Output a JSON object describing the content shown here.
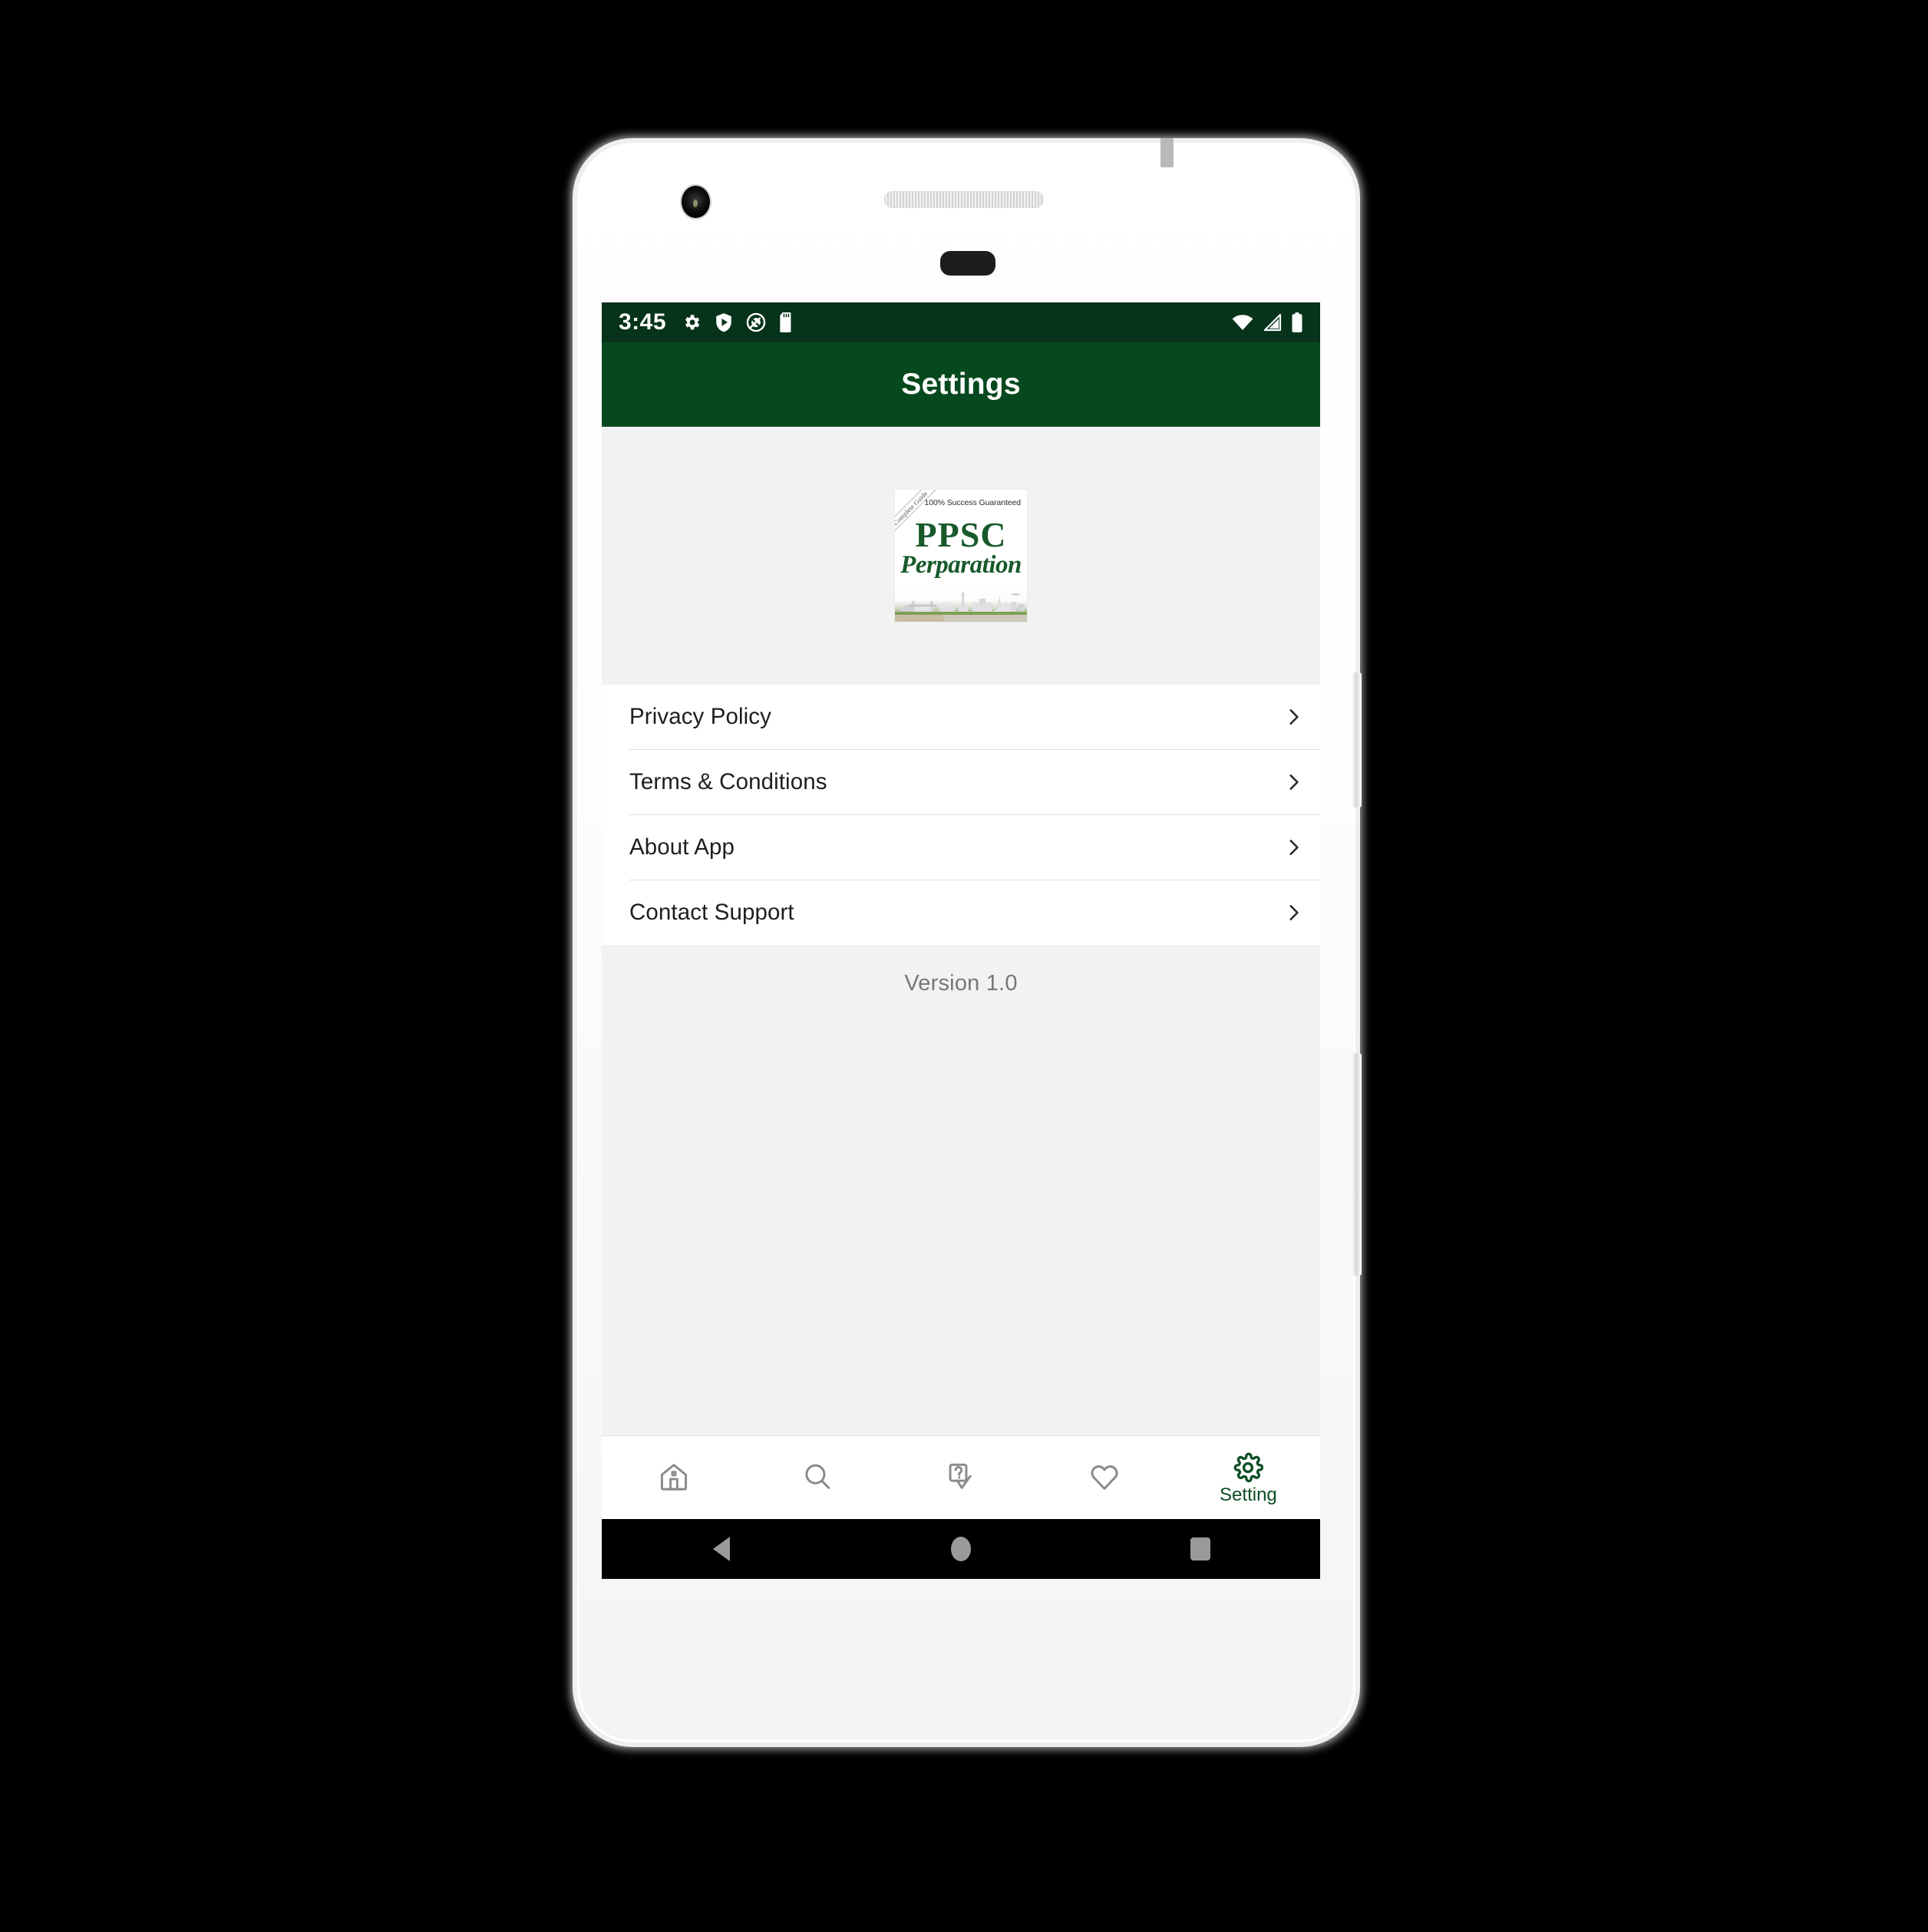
{
  "device": {
    "frame_name": "white-android-phone-mockup",
    "camera_icon": "front-camera-icon",
    "speaker_icon": "earpiece-speaker-icon",
    "power_button": "power-button",
    "volume_button": "volume-button"
  },
  "status_bar": {
    "time": "3:45",
    "left_icons": [
      "gear-icon",
      "play-protect-shield-icon",
      "do-not-disturb-icon",
      "sd-card-icon"
    ],
    "right_icons": [
      "wifi-icon",
      "cellular-signal-icon",
      "battery-full-icon"
    ],
    "background": "#06331a"
  },
  "app_bar": {
    "title": "Settings",
    "background": "#07491e",
    "text_color": "#ffffff"
  },
  "logo": {
    "ribbon": "Complete Guide",
    "tagline": "100% Success Guaranteed",
    "title": "PPSC",
    "subtitle": "Perparation",
    "skyline_icon": "pakistan-skyline-illustration",
    "section_background": "#f2f2f2"
  },
  "settings_list": {
    "items": [
      {
        "label": "Privacy Policy",
        "name": "privacy-policy",
        "chevron": "chevron-right-icon"
      },
      {
        "label": "Terms & Conditions",
        "name": "terms-conditions",
        "chevron": "chevron-right-icon"
      },
      {
        "label": "About App",
        "name": "about-app",
        "chevron": "chevron-right-icon"
      },
      {
        "label": "Contact Support",
        "name": "contact-support",
        "chevron": "chevron-right-icon"
      }
    ]
  },
  "version": {
    "text": "Version 1.0",
    "color": "#777777"
  },
  "bottom_nav": {
    "active_color": "#0c4d23",
    "inactive_color": "#8a8a8a",
    "items": [
      {
        "label": "",
        "icon": "home-icon",
        "name": "nav-home",
        "active": false
      },
      {
        "label": "",
        "icon": "search-icon",
        "name": "nav-search",
        "active": false
      },
      {
        "label": "",
        "icon": "quiz-icon",
        "name": "nav-quiz",
        "active": false
      },
      {
        "label": "",
        "icon": "heart-icon",
        "name": "nav-favorites",
        "active": false
      },
      {
        "label": "Setting",
        "icon": "gear-icon",
        "name": "nav-setting",
        "active": true
      }
    ]
  },
  "android_nav": {
    "back": "back-button",
    "home": "home-button",
    "recents": "recents-button",
    "background": "#000000"
  }
}
